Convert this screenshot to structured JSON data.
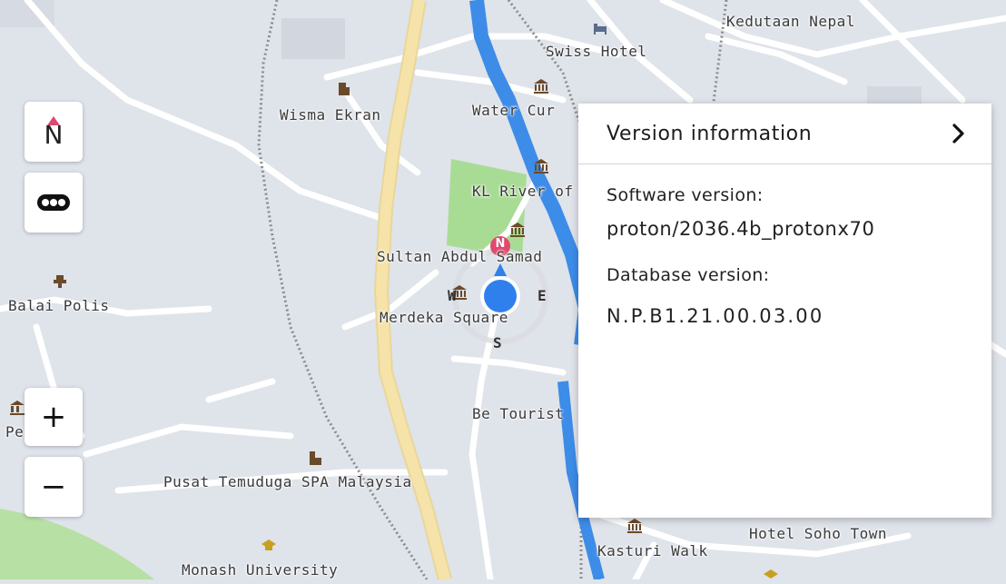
{
  "map": {
    "labels": {
      "kedutaan_nepal": "Kedutaan Nepal",
      "swiss_hotel": "Swiss Hotel",
      "wisma_ekran": "Wisma Ekran",
      "water_cur": "Water Cur",
      "kl_river": "KL River of",
      "sultan_abdul_samad": "Sultan Abdul Samad",
      "balai_polis": "Balai Polis",
      "merdeka_square": "Merdeka Square",
      "be_tourist": "Be Tourist",
      "perdana": "Perdana",
      "pusat_temuduga": "Pusat Temuduga SPA Malaysia",
      "kasturi_walk": "Kasturi Walk",
      "hotel_soho_town": "Hotel Soho Town",
      "monash_university": "Monash University"
    },
    "compass_rose": {
      "n": "N",
      "e": "E",
      "s": "S",
      "w": "W"
    },
    "colors": {
      "river": "#3d8ce8",
      "main_road": "#f6e3a9",
      "park": "#a8dc94",
      "location": "#2f80ed",
      "north": "#e0486f"
    }
  },
  "controls": {
    "north_label": "N",
    "traffic_icon": "traffic-icon",
    "zoom_in_label": "+",
    "zoom_out_label": "−"
  },
  "panel": {
    "title": "Version information",
    "chevron": "›",
    "software_label": "Software version:",
    "software_value": "proton/2036.4b_protonx70",
    "database_label": "Database version:",
    "database_value": "N.P.B1.21.00.03.00"
  }
}
